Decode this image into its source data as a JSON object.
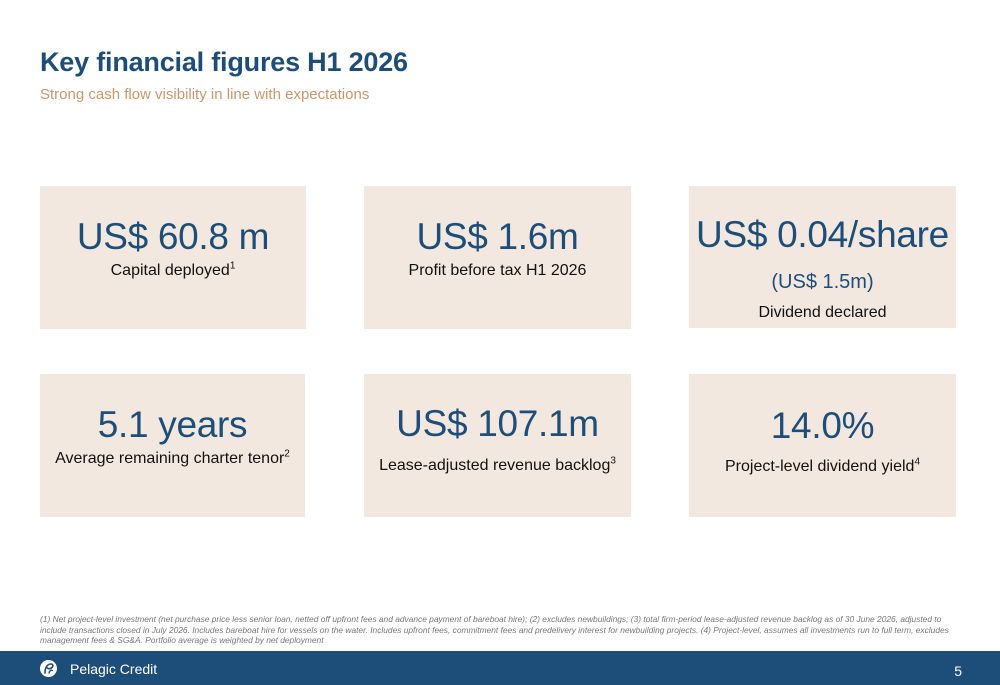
{
  "title": "Key financial figures H1 2026",
  "subtitle": "Strong cash flow visibility in line with expectations",
  "cards": [
    {
      "value": "US$ 60.8 m",
      "label": "Capital deployed",
      "note": "1"
    },
    {
      "value": "US$ 1.6m",
      "label": "Profit before tax H1 2026"
    },
    {
      "value": "US$ 0.04/share",
      "secondary": "(US$ 1.5m)",
      "label": "Dividend declared"
    },
    {
      "value": "5.1 years",
      "label": "Average remaining charter tenor",
      "note": "2"
    },
    {
      "value": "US$ 107.1m",
      "label": "Lease-adjusted revenue backlog",
      "note": "3"
    },
    {
      "value": "14.0%",
      "label": "Project-level dividend yield",
      "note": "4"
    }
  ],
  "footnote": "(1) Net project-level investment (net purchase price less senior loan, netted off upfront fees and advance payment of bareboat hire); (2) excludes newbuildings; (3) total firm-period lease-adjusted revenue backlog as of 30 June 2026, adjusted to include transactions closed in July 2026. Includes bareboat hire for vessels on the water. Includes upfront fees, commitment fees and predelivery interest for newbuilding projects. (4) Project-level, assumes all investments run to full term, excludes management fees & SG&A. Portfolio average is weighted by net deployment",
  "footer": {
    "brand": "Pelagic Credit",
    "page_number": "5",
    "logo_icon": "pelagic-logo-icon"
  },
  "colors": {
    "primary": "#1d4e79",
    "accent": "#c9976b",
    "card_background": "#f3e8e0"
  }
}
